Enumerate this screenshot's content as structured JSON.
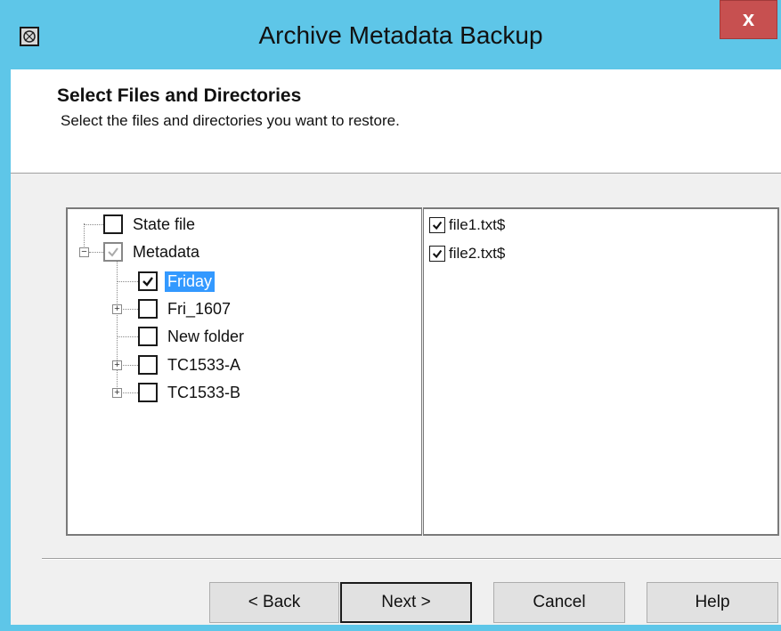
{
  "window": {
    "title": "Archive Metadata Backup",
    "close_label": "x",
    "icon": "app-icon"
  },
  "header": {
    "title": "Select Files and Directories",
    "subtitle": "Select the files and directories you want to restore."
  },
  "tree": {
    "nodes": [
      {
        "label": "State file",
        "checked": false,
        "level": 0,
        "expandable": false
      },
      {
        "label": "Metadata",
        "checked": "partial",
        "level": 0,
        "expandable": true,
        "expanded": true
      },
      {
        "label": "Friday",
        "checked": true,
        "level": 1,
        "expandable": false,
        "selected": true
      },
      {
        "label": "Fri_1607",
        "checked": false,
        "level": 1,
        "expandable": true,
        "expanded": false
      },
      {
        "label": "New folder",
        "checked": false,
        "level": 1,
        "expandable": false
      },
      {
        "label": "TC1533-A",
        "checked": false,
        "level": 1,
        "expandable": true,
        "expanded": false
      },
      {
        "label": "TC1533-B",
        "checked": false,
        "level": 1,
        "expandable": true,
        "expanded": false
      }
    ]
  },
  "files": {
    "items": [
      {
        "label": "file1.txt$",
        "checked": true
      },
      {
        "label": "file2.txt$",
        "checked": true
      }
    ]
  },
  "buttons": {
    "back": "< Back",
    "next": "Next >",
    "cancel": "Cancel",
    "help": "Help"
  },
  "colors": {
    "titlebar": "#5ec6e8",
    "close": "#c75050",
    "selection": "#3399ff"
  }
}
